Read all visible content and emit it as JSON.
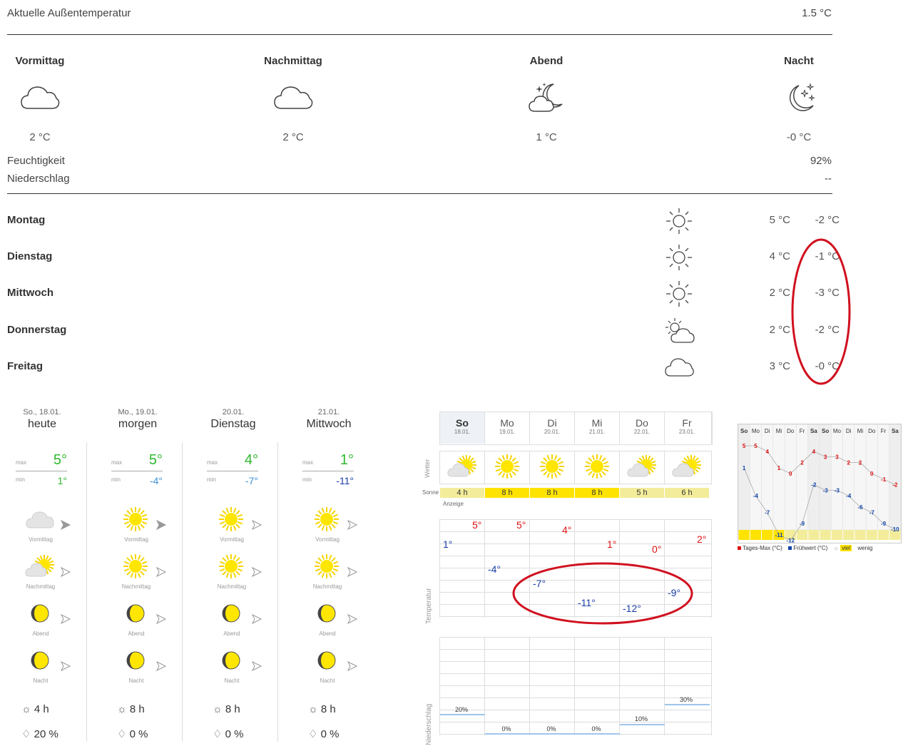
{
  "current": {
    "label": "Aktuelle Außentemperatur",
    "value": "1.5 °C"
  },
  "periods": [
    {
      "label": "Vormittag",
      "icon": "cloud-icon",
      "temp": "2 °C"
    },
    {
      "label": "Nachmittag",
      "icon": "cloud-icon",
      "temp": "2 °C"
    },
    {
      "label": "Abend",
      "icon": "moon-cloud-stars-icon",
      "temp": "1 °C"
    },
    {
      "label": "Nacht",
      "icon": "moon-stars-icon",
      "temp": "-0 °C"
    }
  ],
  "humidity": {
    "label": "Feuchtigkeit",
    "value": "92%"
  },
  "precipitation": {
    "label": "Niederschlag",
    "value": "--"
  },
  "days": [
    {
      "name": "Montag",
      "icon": "sun-icon",
      "max": "5 °C",
      "min": "-2 °C"
    },
    {
      "name": "Dienstag",
      "icon": "sun-icon",
      "max": "4 °C",
      "min": "-1 °C"
    },
    {
      "name": "Mittwoch",
      "icon": "sun-icon",
      "max": "2 °C",
      "min": "-3 °C"
    },
    {
      "name": "Donnerstag",
      "icon": "sun-cloud-icon",
      "max": "2 °C",
      "min": "-2 °C"
    },
    {
      "name": "Freitag",
      "icon": "cloud-icon",
      "max": "3 °C",
      "min": "-0 °C"
    }
  ],
  "forecast": [
    {
      "date": "So., 18.01.",
      "name": "heute",
      "max": "5°",
      "min": "1°",
      "min_color": "#2eb82e",
      "slots": [
        {
          "label": "Vormittag",
          "icon": "cloud-icon"
        },
        {
          "label": "Nachmittag",
          "icon": "sun-cloud-icon"
        },
        {
          "label": "Abend",
          "icon": "moon-icon"
        },
        {
          "label": "Nacht",
          "icon": "moon-icon"
        }
      ],
      "sun": "4 h",
      "rain": "20 %"
    },
    {
      "date": "Mo., 19.01.",
      "name": "morgen",
      "max": "5°",
      "min": "-4°",
      "min_color": "#3b8fd9",
      "slots": [
        {
          "label": "Vormittag",
          "icon": "sun-icon"
        },
        {
          "label": "Nachmittag",
          "icon": "sun-icon"
        },
        {
          "label": "Abend",
          "icon": "moon-icon"
        },
        {
          "label": "Nacht",
          "icon": "moon-icon"
        }
      ],
      "sun": "8 h",
      "rain": "0 %"
    },
    {
      "date": "20.01.",
      "name": "Dienstag",
      "max": "4°",
      "min": "-7°",
      "min_color": "#3b8fd9",
      "slots": [
        {
          "label": "Vormittag",
          "icon": "sun-icon"
        },
        {
          "label": "Nachmittag",
          "icon": "sun-icon"
        },
        {
          "label": "Abend",
          "icon": "moon-icon"
        },
        {
          "label": "Nacht",
          "icon": "moon-icon"
        }
      ],
      "sun": "8 h",
      "rain": "0 %"
    },
    {
      "date": "21.01.",
      "name": "Mittwoch",
      "max": "1°",
      "min": "-11°",
      "min_color": "#1a3ea6",
      "slots": [
        {
          "label": "Vormittag",
          "icon": "sun-icon"
        },
        {
          "label": "Nachmittag",
          "icon": "sun-icon"
        },
        {
          "label": "Abend",
          "icon": "moon-icon"
        },
        {
          "label": "Nacht",
          "icon": "moon-icon"
        }
      ],
      "sun": "8 h",
      "rain": "0 %"
    }
  ],
  "forecast_labels": {
    "max": "max",
    "min": "min"
  },
  "table": {
    "days": [
      {
        "d": "So",
        "date": "18.01.",
        "sun": "4 h",
        "maxT": "5°",
        "minT": "1°",
        "rain": "20%",
        "icon": "sun-cloud-icon"
      },
      {
        "d": "Mo",
        "date": "19.01.",
        "sun": "8 h",
        "maxT": "5°",
        "minT": "-4°",
        "rain": "0%",
        "icon": "sun-icon"
      },
      {
        "d": "Di",
        "date": "20.01.",
        "sun": "8 h",
        "maxT": "4°",
        "minT": "-7°",
        "rain": "0%",
        "icon": "sun-icon"
      },
      {
        "d": "Mi",
        "date": "21.01.",
        "sun": "8 h",
        "maxT": "1°",
        "minT": "-11°",
        "rain": "0%",
        "icon": "sun-icon"
      },
      {
        "d": "Do",
        "date": "22.01.",
        "sun": "5 h",
        "maxT": "0°",
        "minT": "-12°",
        "rain": "10%",
        "icon": "sun-cloud-icon"
      },
      {
        "d": "Fr",
        "date": "23.01.",
        "sun": "6 h",
        "maxT": "2°",
        "minT": "-9°",
        "rain": "30%",
        "icon": "sun-cloud-icon"
      }
    ],
    "label_wetter": "Wetter",
    "label_sonne": "Sonne",
    "label_anzeige": "Anzeige",
    "label_temperatur": "Temperatur",
    "label_niederschlag": "Niederschlag"
  },
  "chart_data": {
    "type": "line",
    "categories": [
      "So",
      "Mo",
      "Di",
      "Mi",
      "Do",
      "Fr",
      "Sa",
      "So",
      "Mo",
      "Di",
      "Mi",
      "Do",
      "Fr",
      "Sa"
    ],
    "series": [
      {
        "name": "Tages-Max (°C)",
        "values": [
          5,
          5,
          4,
          1,
          0,
          2,
          4,
          3,
          3,
          2,
          2,
          0,
          -1,
          -2
        ]
      },
      {
        "name": "Frühwert (°C)",
        "values": [
          1,
          -4,
          -7,
          -11,
          -12,
          -9,
          -2,
          -3,
          -3,
          -4,
          -6,
          -7,
          -9,
          -10
        ]
      }
    ],
    "legend_sun": "viel",
    "legend_sun2": "wenig"
  }
}
